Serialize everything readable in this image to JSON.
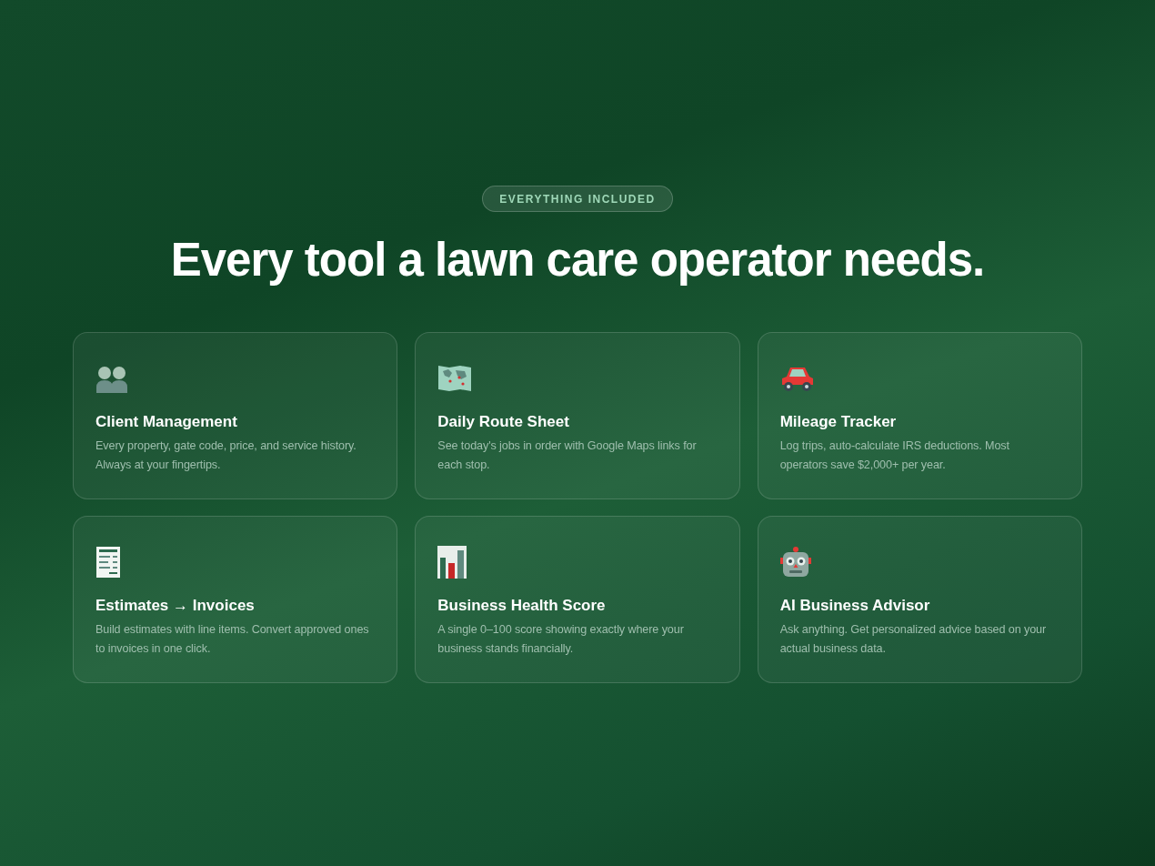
{
  "badge": "EVERYTHING INCLUDED",
  "heading": "Every tool a lawn care operator needs.",
  "features": [
    {
      "title": "Client Management",
      "description": "Every property, gate code, price, and service history. Always at your fingertips."
    },
    {
      "title": "Daily Route Sheet",
      "description": "See today's jobs in order with Google Maps links for each stop."
    },
    {
      "title": "Mileage Tracker",
      "description": "Log trips, auto-calculate IRS deductions. Most operators save $2,000+ per year."
    },
    {
      "title": "Estimates → Invoices",
      "description": "Build estimates with line items. Convert approved ones to invoices in one click."
    },
    {
      "title": "Business Health Score",
      "description": "A single 0–100 score showing exactly where your business stands financially."
    },
    {
      "title": "AI Business Advisor",
      "description": "Ask anything. Get personalized advice based on your actual business data."
    }
  ]
}
